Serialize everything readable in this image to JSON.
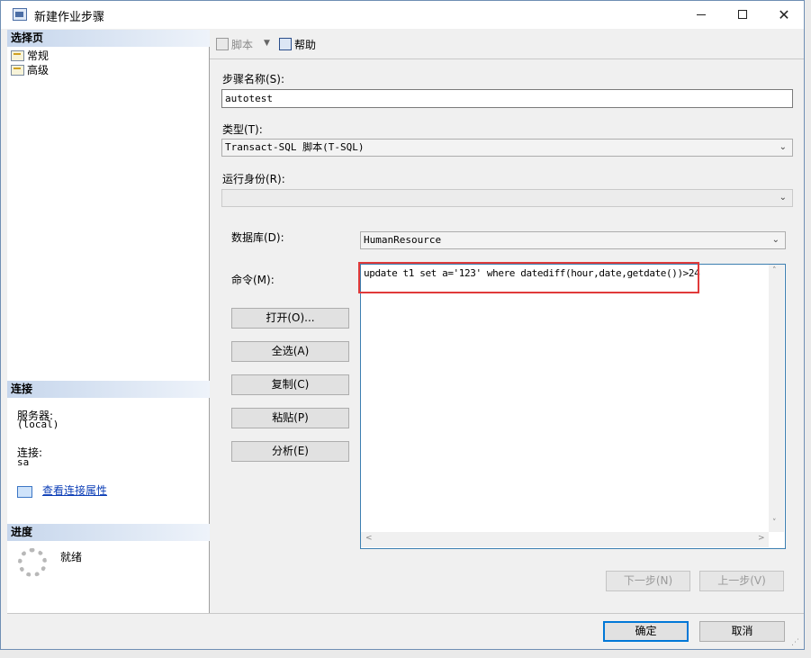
{
  "window": {
    "title": "新建作业步骤",
    "caption": {
      "close_glyph": "✕"
    }
  },
  "left": {
    "select_page_header": "选择页",
    "pages": [
      {
        "label": "常规"
      },
      {
        "label": "高级"
      }
    ],
    "connection_header": "连接",
    "server_label": "服务器:",
    "server_value": "(local)",
    "connection_label": "连接:",
    "connection_value": "sa",
    "view_conn_props": "查看连接属性",
    "progress_header": "进度",
    "progress_status": "就绪"
  },
  "toolbar": {
    "script_label": "脚本",
    "dropdown_glyph": "▼",
    "help_label": "帮助"
  },
  "form": {
    "step_name_label": "步骤名称(S):",
    "step_name_value": "autotest",
    "type_label": "类型(T):",
    "type_value": "Transact-SQL 脚本(T-SQL)",
    "run_as_label": "运行身份(R):",
    "run_as_value": "",
    "database_label": "数据库(D):",
    "database_value": "HumanResource",
    "command_label": "命令(M):",
    "command_value": "update t1 set a='123' where datediff(hour,date,getdate())>24",
    "chevron_glyph": "⌄"
  },
  "buttons": {
    "open": "打开(O)...",
    "select_all": "全选(A)",
    "copy": "复制(C)",
    "paste": "粘贴(P)",
    "parse": "分析(E)",
    "next": "下一步(N)",
    "previous": "上一步(V)",
    "ok": "确定",
    "cancel": "取消"
  },
  "scroll_glyphs": {
    "up": "˄",
    "down": "˅",
    "left": "<",
    "right": ">"
  },
  "colors": {
    "accent": "#0078d7",
    "highlight_border": "#e03a3a",
    "link": "#0b3db6"
  }
}
